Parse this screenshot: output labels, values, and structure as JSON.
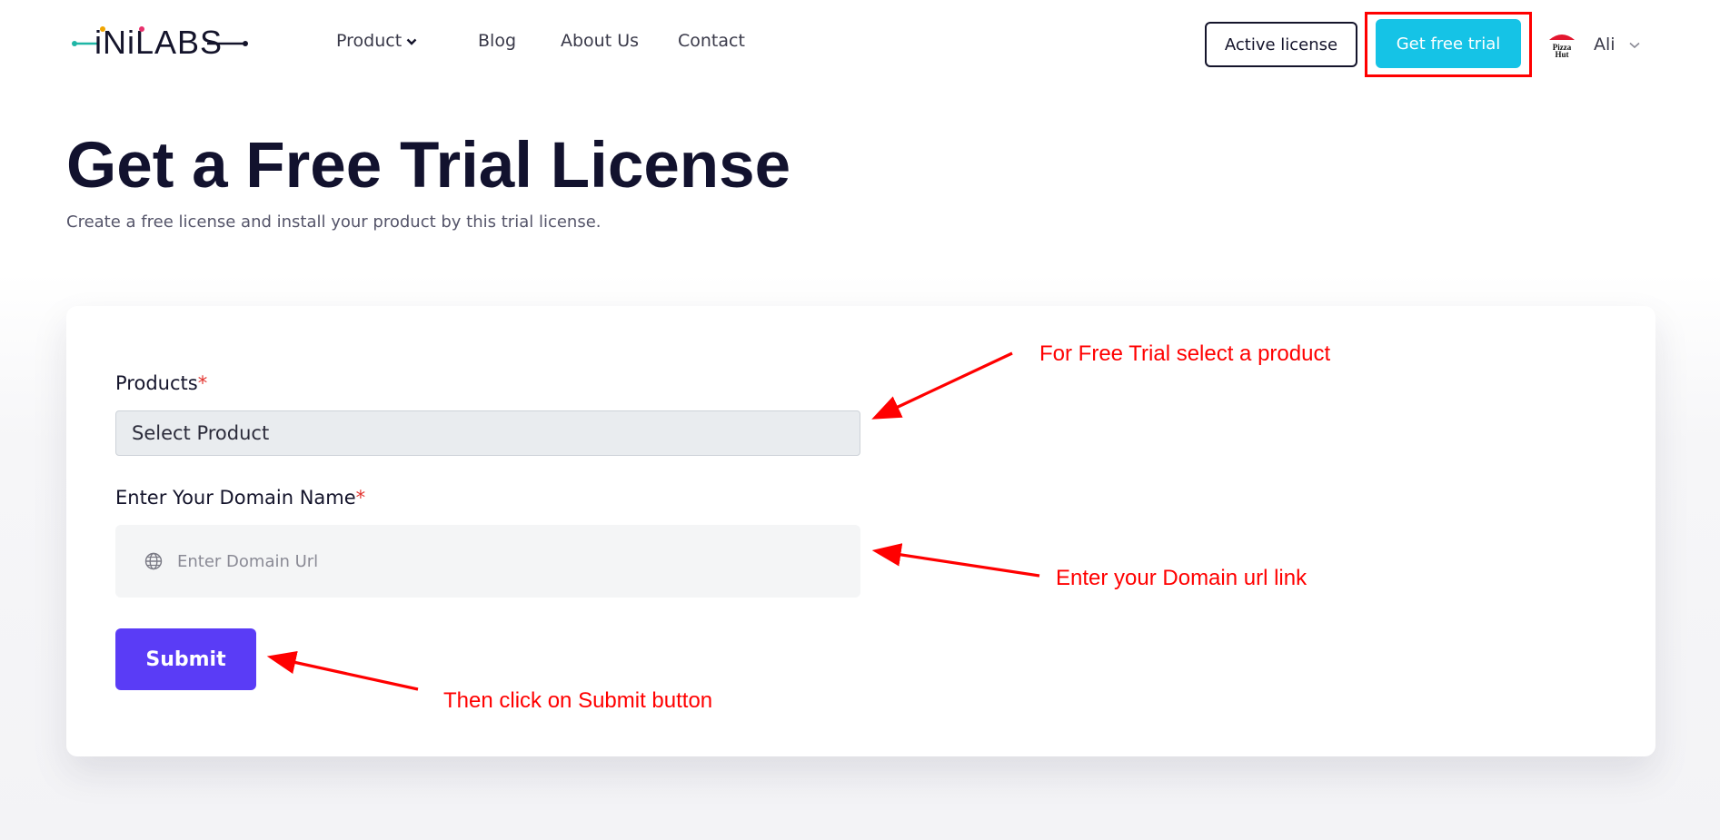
{
  "header": {
    "logo_text": "iNiLABS",
    "nav": [
      {
        "label": "Product",
        "has_dropdown": true
      },
      {
        "label": "Blog"
      },
      {
        "label": "About Us"
      },
      {
        "label": "Contact"
      }
    ],
    "active_license_label": "Active license",
    "free_trial_label": "Get free trial",
    "user": {
      "name": "Ali",
      "avatar_text": "Pizza Hut"
    }
  },
  "hero": {
    "title": "Get a Free Trial License",
    "subtitle": "Create a free license and install your product by this trial license."
  },
  "form": {
    "products_label": "Products",
    "required_mark": "*",
    "product_select_value": "Select Product",
    "domain_label": "Enter Your Domain Name",
    "domain_placeholder": "Enter Domain Url",
    "submit_label": "Submit"
  },
  "annotations": {
    "select_product": "For Free Trial select a product",
    "domain_url": "Enter your Domain url link",
    "submit": "Then click on Submit button"
  },
  "colors": {
    "accent_trial": "#15c3e6",
    "submit": "#5a3cf6",
    "annotation": "#ff0000",
    "title": "#12122e"
  }
}
